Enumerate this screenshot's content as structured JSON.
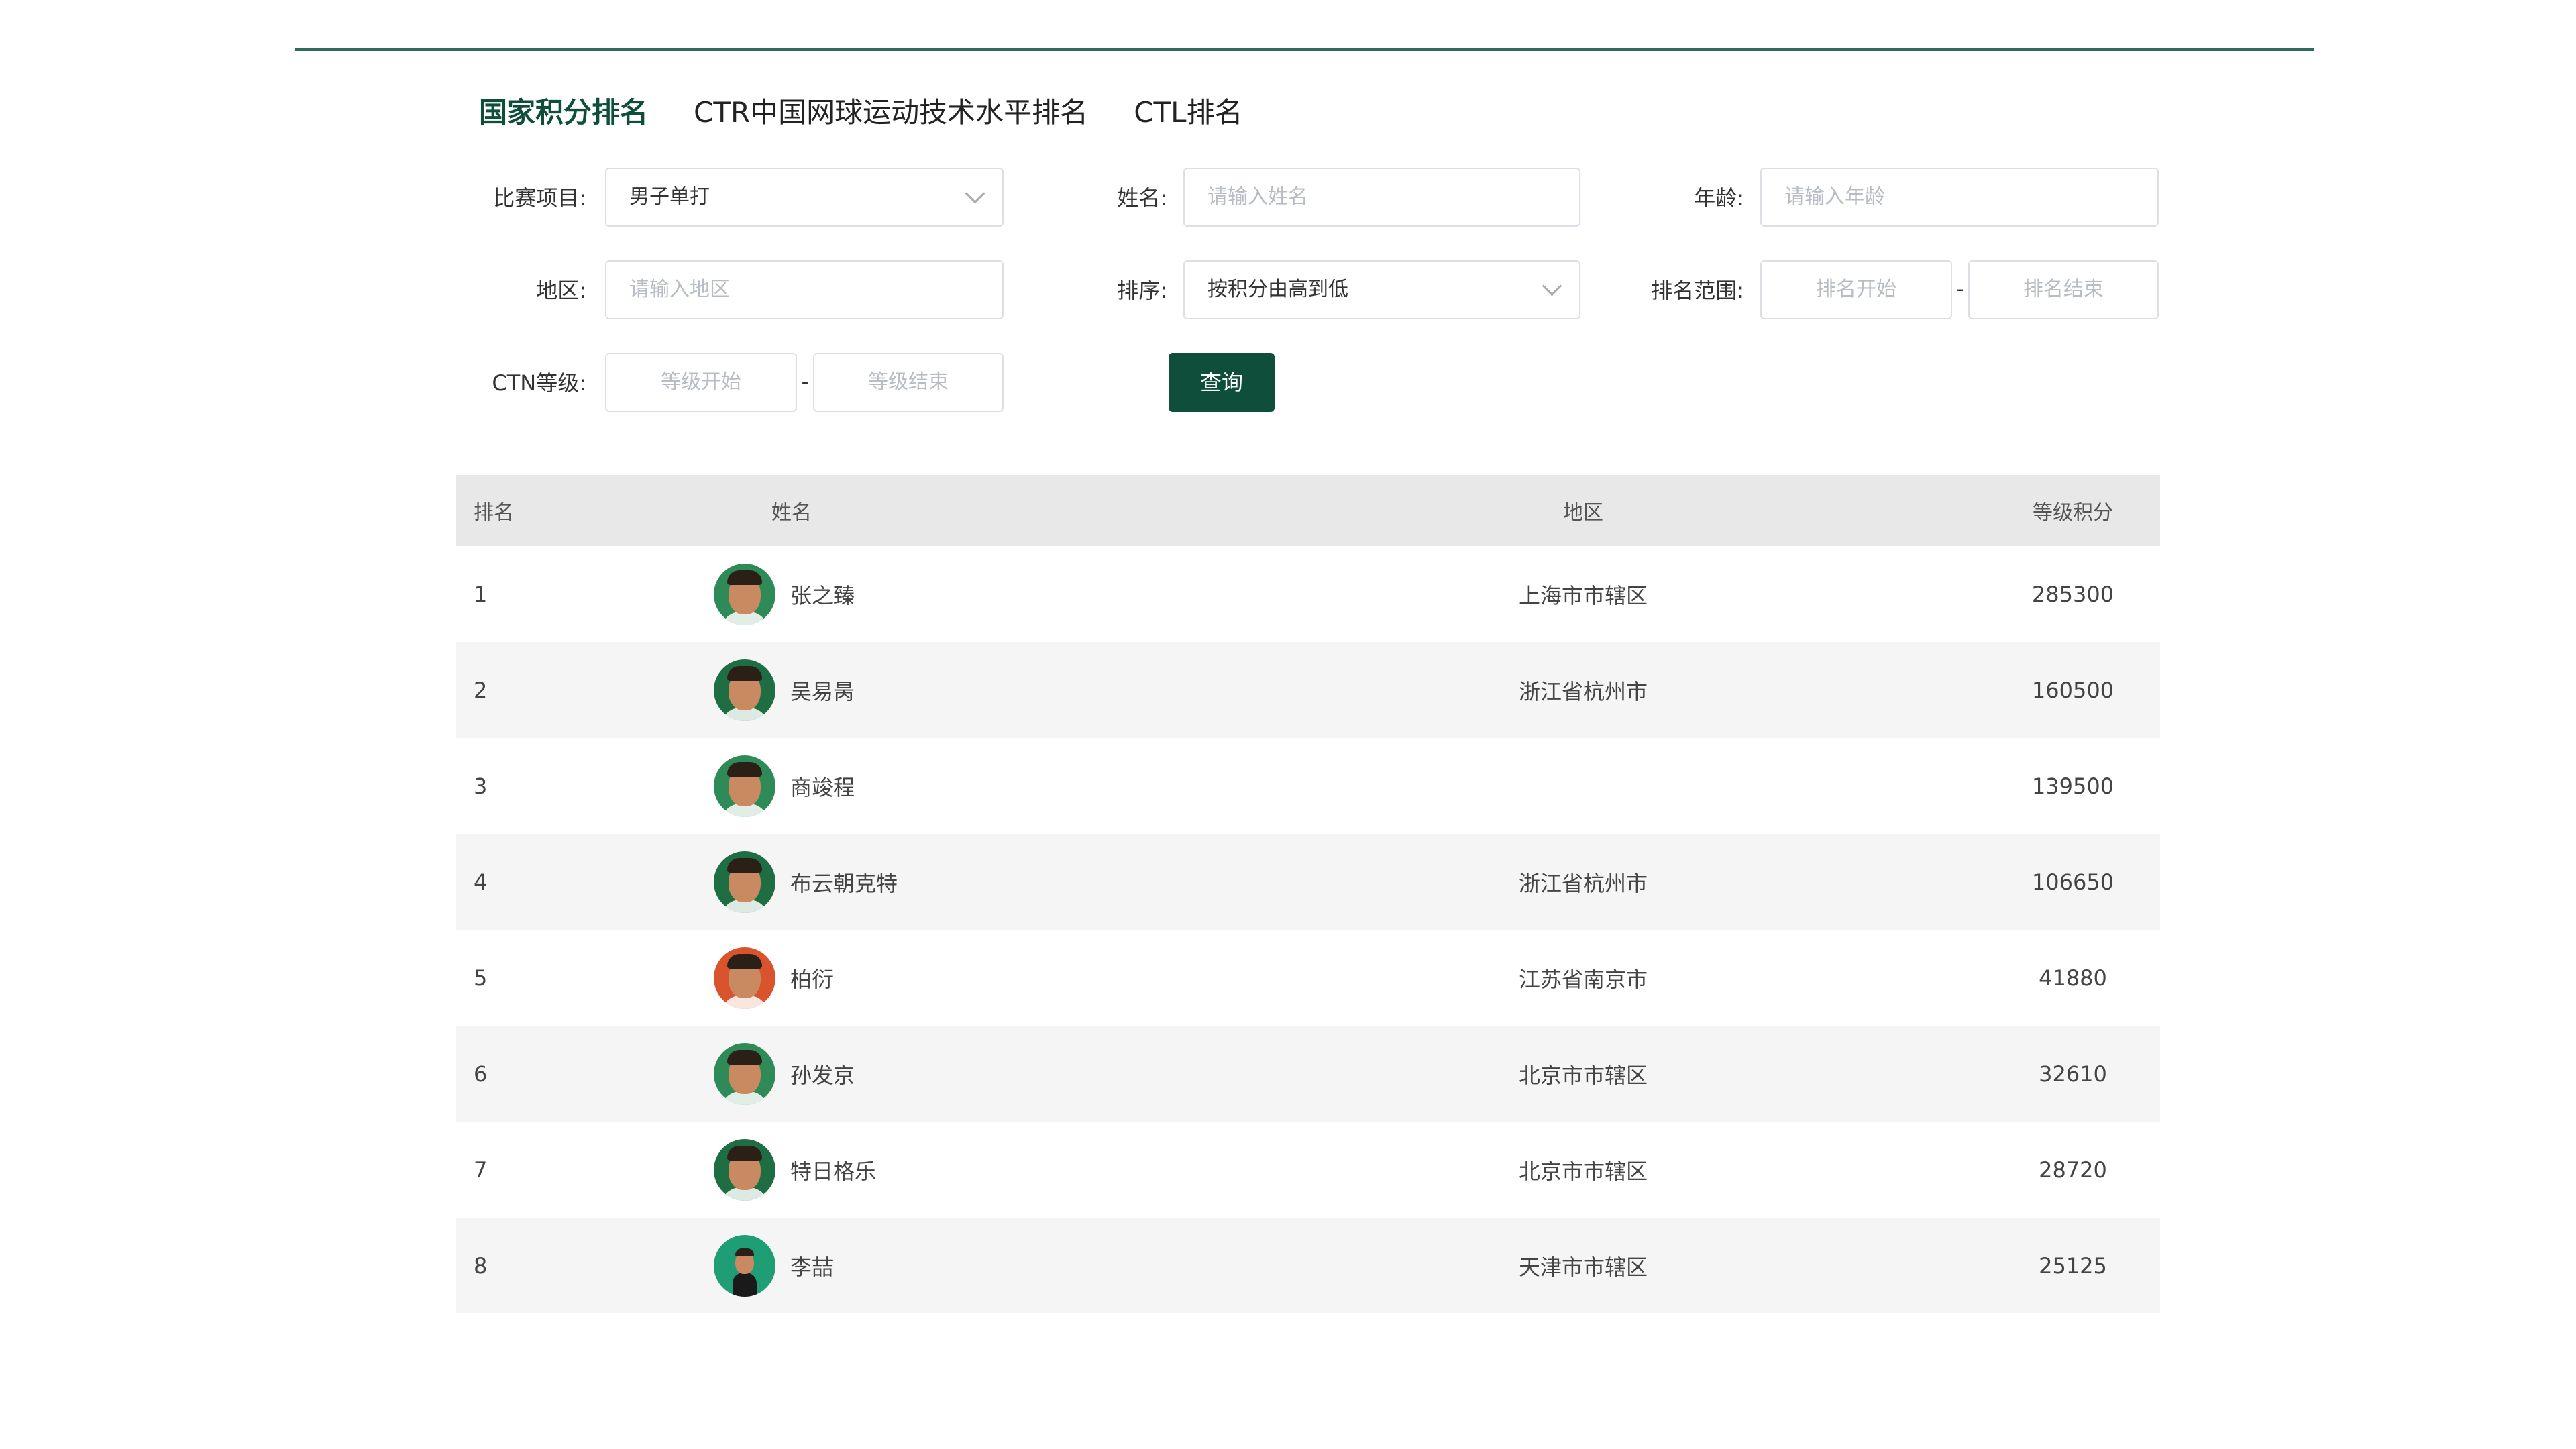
{
  "tabs": [
    {
      "label": "国家积分排名",
      "active": true
    },
    {
      "label": "CTR中国网球运动技术水平排名",
      "active": false
    },
    {
      "label": "CTL排名",
      "active": false
    }
  ],
  "filters": {
    "event_label": "比赛项目:",
    "event_value": "男子单打",
    "name_label": "姓名:",
    "name_placeholder": "请输入姓名",
    "age_label": "年龄:",
    "age_placeholder": "请输入年龄",
    "region_label": "地区:",
    "region_placeholder": "请输入地区",
    "sort_label": "排序:",
    "sort_value": "按积分由高到低",
    "rank_range_label": "排名范围:",
    "rank_start_placeholder": "排名开始",
    "rank_end_placeholder": "排名结束",
    "ctn_label": "CTN等级:",
    "level_start_placeholder": "等级开始",
    "level_end_placeholder": "等级结束",
    "range_separator": "-",
    "query_button": "查询"
  },
  "table": {
    "headers": {
      "rank": "排名",
      "name": "姓名",
      "region": "地区",
      "points": "等级积分"
    },
    "rows": [
      {
        "rank": "1",
        "name": "张之臻",
        "region": "上海市市辖区",
        "points": "285300"
      },
      {
        "rank": "2",
        "name": "吴易昺",
        "region": "浙江省杭州市",
        "points": "160500"
      },
      {
        "rank": "3",
        "name": "商竣程",
        "region": "",
        "points": "139500"
      },
      {
        "rank": "4",
        "name": "布云朝克特",
        "region": "浙江省杭州市",
        "points": "106650"
      },
      {
        "rank": "5",
        "name": "柏衍",
        "region": "江苏省南京市",
        "points": "41880"
      },
      {
        "rank": "6",
        "name": "孙发京",
        "region": "北京市市辖区",
        "points": "32610"
      },
      {
        "rank": "7",
        "name": "特日格乐",
        "region": "北京市市辖区",
        "points": "28720"
      },
      {
        "rank": "8",
        "name": "李喆",
        "region": "天津市市辖区",
        "points": "25125"
      }
    ]
  },
  "colors": {
    "brand": "#0e4e3a",
    "header_bg": "#e8e8e8",
    "stripe_bg": "#f5f5f5"
  }
}
